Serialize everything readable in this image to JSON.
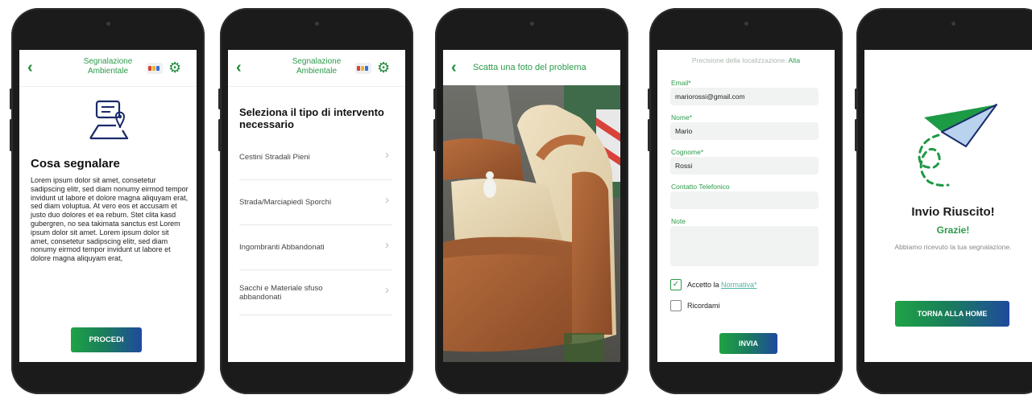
{
  "header": {
    "title_line1": "Segnalazione",
    "title_line2": "Ambientale"
  },
  "screen_info": {
    "title": "Cosa segnalare",
    "body": "Lorem ipsum dolor sit amet, consetetur sadipscing elitr, sed diam nonumy eirmod tempor invidunt ut labore et dolore magna aliquyam erat, sed diam voluptua. At vero eos et accusam et justo duo dolores et ea rebum. Stet clita kasd gubergren, no sea takimata sanctus est Lorem ipsum dolor sit amet. Lorem ipsum dolor sit amet, consetetur sadipscing elitr, sed diam nonumy eirmod tempor invidunt ut labore et dolore magna aliquyam erat,",
    "button": "PROCEDI"
  },
  "screen_type": {
    "heading": "Seleziona il tipo di intervento necessario",
    "options": [
      "Cestini Stradali Pieni",
      "Strada/Marciapiedi Sporchi",
      "Ingombranti Abbandonati",
      "Sacchi e Materiale sfuso abbandonati"
    ]
  },
  "screen_photo": {
    "title": "Scatta una foto del problema"
  },
  "screen_form": {
    "precision_label": "Precisione della localizzazione:",
    "precision_value": "Alta",
    "email_label": "Email*",
    "email_value": "mariorossi@gmail.com",
    "nome_label": "Nome*",
    "nome_value": "Mario",
    "cognome_label": "Cognome*",
    "cognome_value": "Rossi",
    "telefono_label": "Contatto Telefonico",
    "telefono_value": "",
    "note_label": "Note",
    "note_value": "",
    "accept_text": "Accetto la",
    "accept_link": "Normativa*",
    "accept_checked": true,
    "remember_label": "Ricordami",
    "remember_checked": false,
    "button": "INVIA"
  },
  "screen_success": {
    "title": "Invio Riuscito!",
    "subtitle": "Grazie!",
    "text": "Abbiamo ricevuto la tua segnalazione.",
    "button": "TORNA ALLA HOME"
  },
  "colors": {
    "brand_green": "#2c9a4a",
    "brand_blue": "#1f4a9c",
    "paper_plane": "#1d9a45"
  },
  "icons": [
    "back-chevron-icon",
    "municipality-logo",
    "gear-icon",
    "report-info-icon",
    "chevron-right-icon",
    "checkbox-check-icon",
    "paper-plane-icon"
  ]
}
